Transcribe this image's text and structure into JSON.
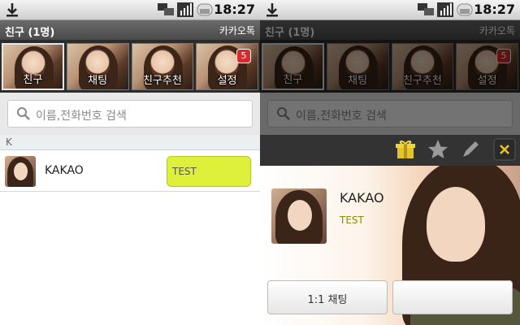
{
  "status_bar": {
    "time": "18:27",
    "icons": [
      "download-icon",
      "sync-icon",
      "signal-icon",
      "battery-icon"
    ]
  },
  "title_bar": {
    "left": "친구 (1명)",
    "right": "카카오톡"
  },
  "tabs": [
    {
      "label": "친구",
      "badge": ""
    },
    {
      "label": "채팅",
      "badge": ""
    },
    {
      "label": "친구추천",
      "badge": ""
    },
    {
      "label": "설정",
      "badge": "5"
    }
  ],
  "search": {
    "placeholder": "이름,전화번호 검색"
  },
  "friends": {
    "section_header": "K",
    "rows": [
      {
        "name": "KAKAO",
        "status": "TEST"
      }
    ]
  },
  "profile": {
    "name": "KAKAO",
    "status": "TEST",
    "buttons": {
      "chat": "1:1 채팅",
      "second": ""
    },
    "toolbar_icons": [
      "gift-icon",
      "star-icon",
      "pencil-icon",
      "close-icon"
    ]
  },
  "colors": {
    "status_highlight": "#dff03a",
    "badge": "#d62b2b"
  }
}
